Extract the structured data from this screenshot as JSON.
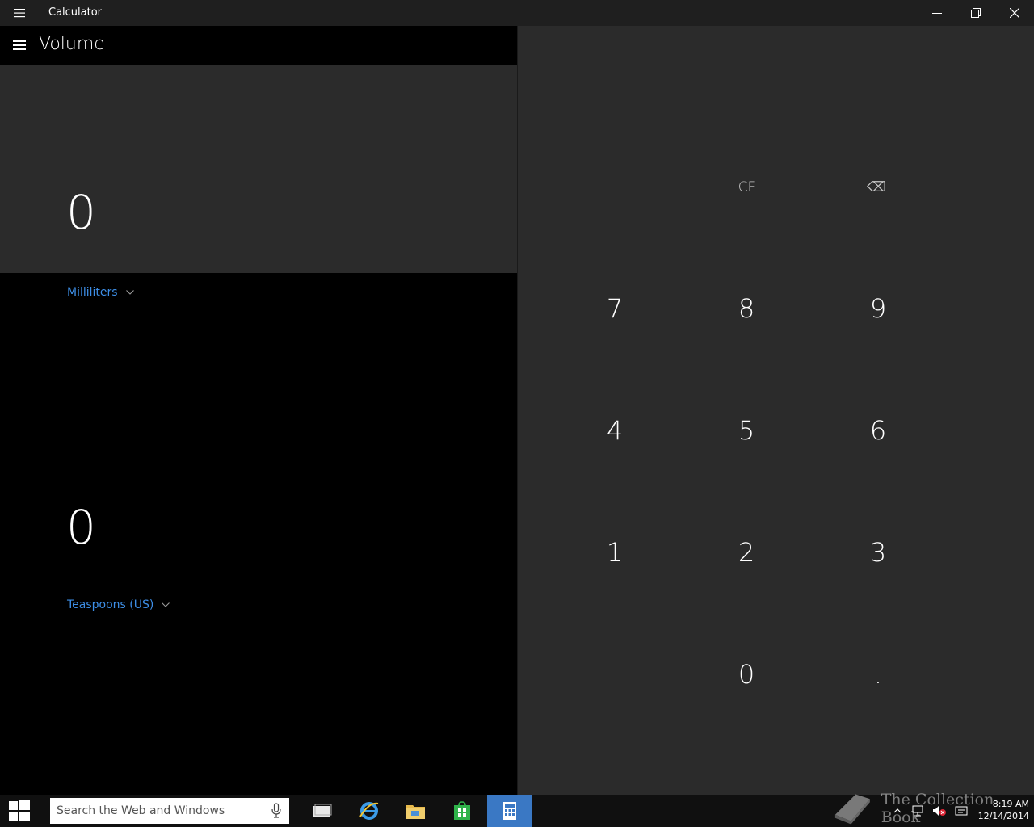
{
  "window": {
    "title": "Calculator"
  },
  "header": {
    "mode": "Volume"
  },
  "converter": {
    "from_value": "0",
    "from_unit": "Milliliters",
    "to_value": "0",
    "to_unit": "Teaspoons (US)"
  },
  "keypad": {
    "ce": "CE",
    "backspace": "⌫",
    "k7": "7",
    "k8": "8",
    "k9": "9",
    "k4": "4",
    "k5": "5",
    "k6": "6",
    "k1": "1",
    "k2": "2",
    "k3": "3",
    "k0": "0",
    "decimal": "."
  },
  "taskbar": {
    "search_placeholder": "Search the Web and Windows",
    "time": "8:19 AM",
    "date": "12/14/2014"
  },
  "watermark": {
    "text": "The Collection Book"
  },
  "colors": {
    "accent": "#3d8ee6",
    "keypad_bg": "#2b2b2b",
    "taskbar_active": "#3a78c4"
  }
}
